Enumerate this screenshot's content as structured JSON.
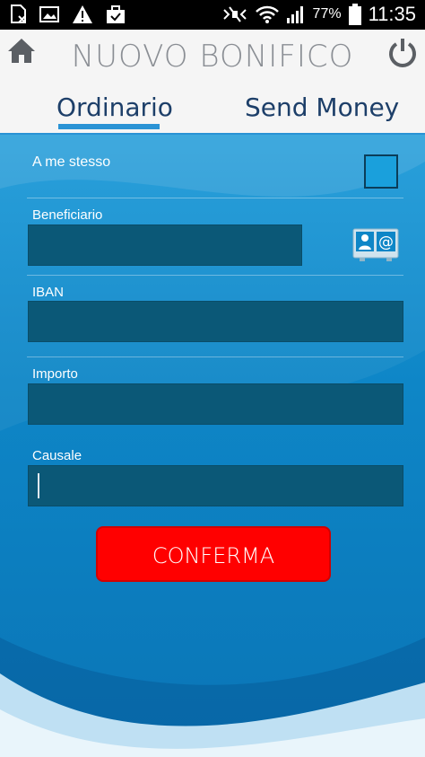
{
  "statusbar": {
    "battery_percent": "77%",
    "time": "11:35",
    "icons": [
      "sim-icon",
      "image-icon",
      "warning-icon",
      "briefcase-icon",
      "mute-icon",
      "wifi-icon",
      "signal-icon",
      "battery-icon"
    ]
  },
  "header": {
    "title": "NUOVO BONIFICO",
    "home_icon": "home-icon",
    "power_icon": "power-icon"
  },
  "tabs": [
    {
      "label": "Ordinario",
      "active": true
    },
    {
      "label": "Send Money",
      "active": false
    }
  ],
  "form": {
    "self_label": "A me stesso",
    "beneficiary_label": "Beneficiario",
    "iban_label": "IBAN",
    "amount_label": "Importo",
    "reason_label": "Causale"
  },
  "confirm_label": "CONFERMA",
  "colors": {
    "header_bg": "#f5f5f5",
    "title": "#8a8e94",
    "tab_text": "#1d3f69",
    "accent": "#2a93d5",
    "field_bg": "#0b5877",
    "confirm_bg": "#ff0000"
  }
}
